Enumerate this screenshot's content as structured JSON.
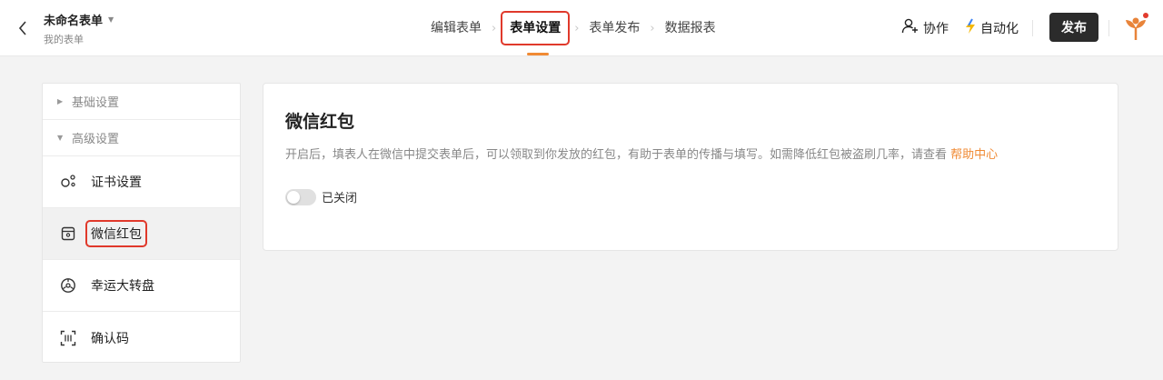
{
  "header": {
    "form_title": "未命名表单",
    "form_subtitle": "我的表单",
    "nav": [
      {
        "label": "编辑表单",
        "active": false
      },
      {
        "label": "表单设置",
        "active": true
      },
      {
        "label": "表单发布",
        "active": false
      },
      {
        "label": "数据报表",
        "active": false
      }
    ],
    "collab_label": "协作",
    "automation_label": "自动化",
    "publish_label": "发布"
  },
  "sidebar": {
    "groups": [
      {
        "label": "基础设置",
        "expanded": false
      },
      {
        "label": "高级设置",
        "expanded": true
      }
    ],
    "items": [
      {
        "label": "证书设置",
        "icon": "certificate-icon",
        "selected": false
      },
      {
        "label": "微信红包",
        "icon": "red-envelope-icon",
        "selected": true
      },
      {
        "label": "幸运大转盘",
        "icon": "lucky-wheel-icon",
        "selected": false
      },
      {
        "label": "确认码",
        "icon": "scan-code-icon",
        "selected": false
      }
    ]
  },
  "panel": {
    "title": "微信红包",
    "description": "开启后，填表人在微信中提交表单后，可以领取到你发放的红包，有助于表单的传播与填写。如需降低红包被盗刷几率，请查看",
    "help_link": "帮助中心",
    "toggle_state": "已关闭",
    "toggle_on": false
  },
  "colors": {
    "accent": "#f08a34",
    "highlight_box": "#e0392b",
    "publish_bg": "#2b2b2b"
  }
}
